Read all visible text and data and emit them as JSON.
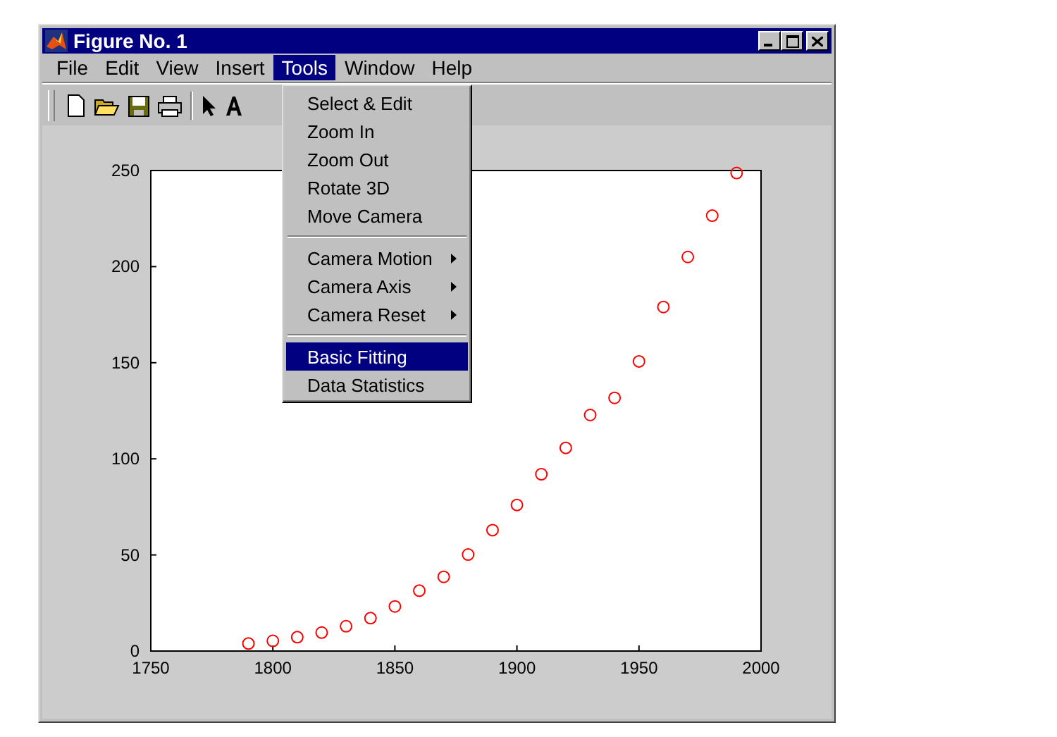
{
  "window": {
    "title": "Figure No. 1"
  },
  "menu_bar": [
    {
      "label": "File",
      "selected": false
    },
    {
      "label": "Edit",
      "selected": false
    },
    {
      "label": "View",
      "selected": false
    },
    {
      "label": "Insert",
      "selected": false
    },
    {
      "label": "Tools",
      "selected": true
    },
    {
      "label": "Window",
      "selected": false
    },
    {
      "label": "Help",
      "selected": false
    }
  ],
  "tools_menu": {
    "items": [
      {
        "kind": "item",
        "label": "Select & Edit",
        "submenu": false,
        "selected": false
      },
      {
        "kind": "item",
        "label": "Zoom In",
        "submenu": false,
        "selected": false
      },
      {
        "kind": "item",
        "label": "Zoom Out",
        "submenu": false,
        "selected": false
      },
      {
        "kind": "item",
        "label": "Rotate 3D",
        "submenu": false,
        "selected": false
      },
      {
        "kind": "item",
        "label": "Move Camera",
        "submenu": false,
        "selected": false
      },
      {
        "kind": "separator"
      },
      {
        "kind": "item",
        "label": "Camera Motion",
        "submenu": true,
        "selected": false
      },
      {
        "kind": "item",
        "label": "Camera Axis",
        "submenu": true,
        "selected": false
      },
      {
        "kind": "item",
        "label": "Camera Reset",
        "submenu": true,
        "selected": false
      },
      {
        "kind": "separator"
      },
      {
        "kind": "item",
        "label": "Basic Fitting",
        "submenu": false,
        "selected": true
      },
      {
        "kind": "item",
        "label": "Data Statistics",
        "submenu": false,
        "selected": false
      }
    ]
  },
  "plot": {
    "chart_data": {
      "type": "scatter",
      "xlim": [
        1750,
        2000
      ],
      "ylim": [
        0,
        250
      ],
      "xticks": [
        1750,
        1800,
        1850,
        1900,
        1950,
        2000
      ],
      "yticks": [
        0,
        50,
        100,
        150,
        200,
        250
      ],
      "series": [
        {
          "color": "#ff0000",
          "x": [
            1790,
            1800,
            1810,
            1820,
            1830,
            1840,
            1850,
            1860,
            1870,
            1880,
            1890,
            1900,
            1910,
            1920,
            1930,
            1940,
            1950,
            1960,
            1970,
            1980,
            1990
          ],
          "values": [
            3.9,
            5.3,
            7.2,
            9.6,
            12.9,
            17.1,
            23.2,
            31.4,
            38.6,
            50.2,
            62.9,
            76.0,
            92.0,
            105.7,
            122.8,
            131.7,
            150.7,
            179.0,
            205.0,
            226.5,
            248.7
          ]
        }
      ]
    }
  }
}
